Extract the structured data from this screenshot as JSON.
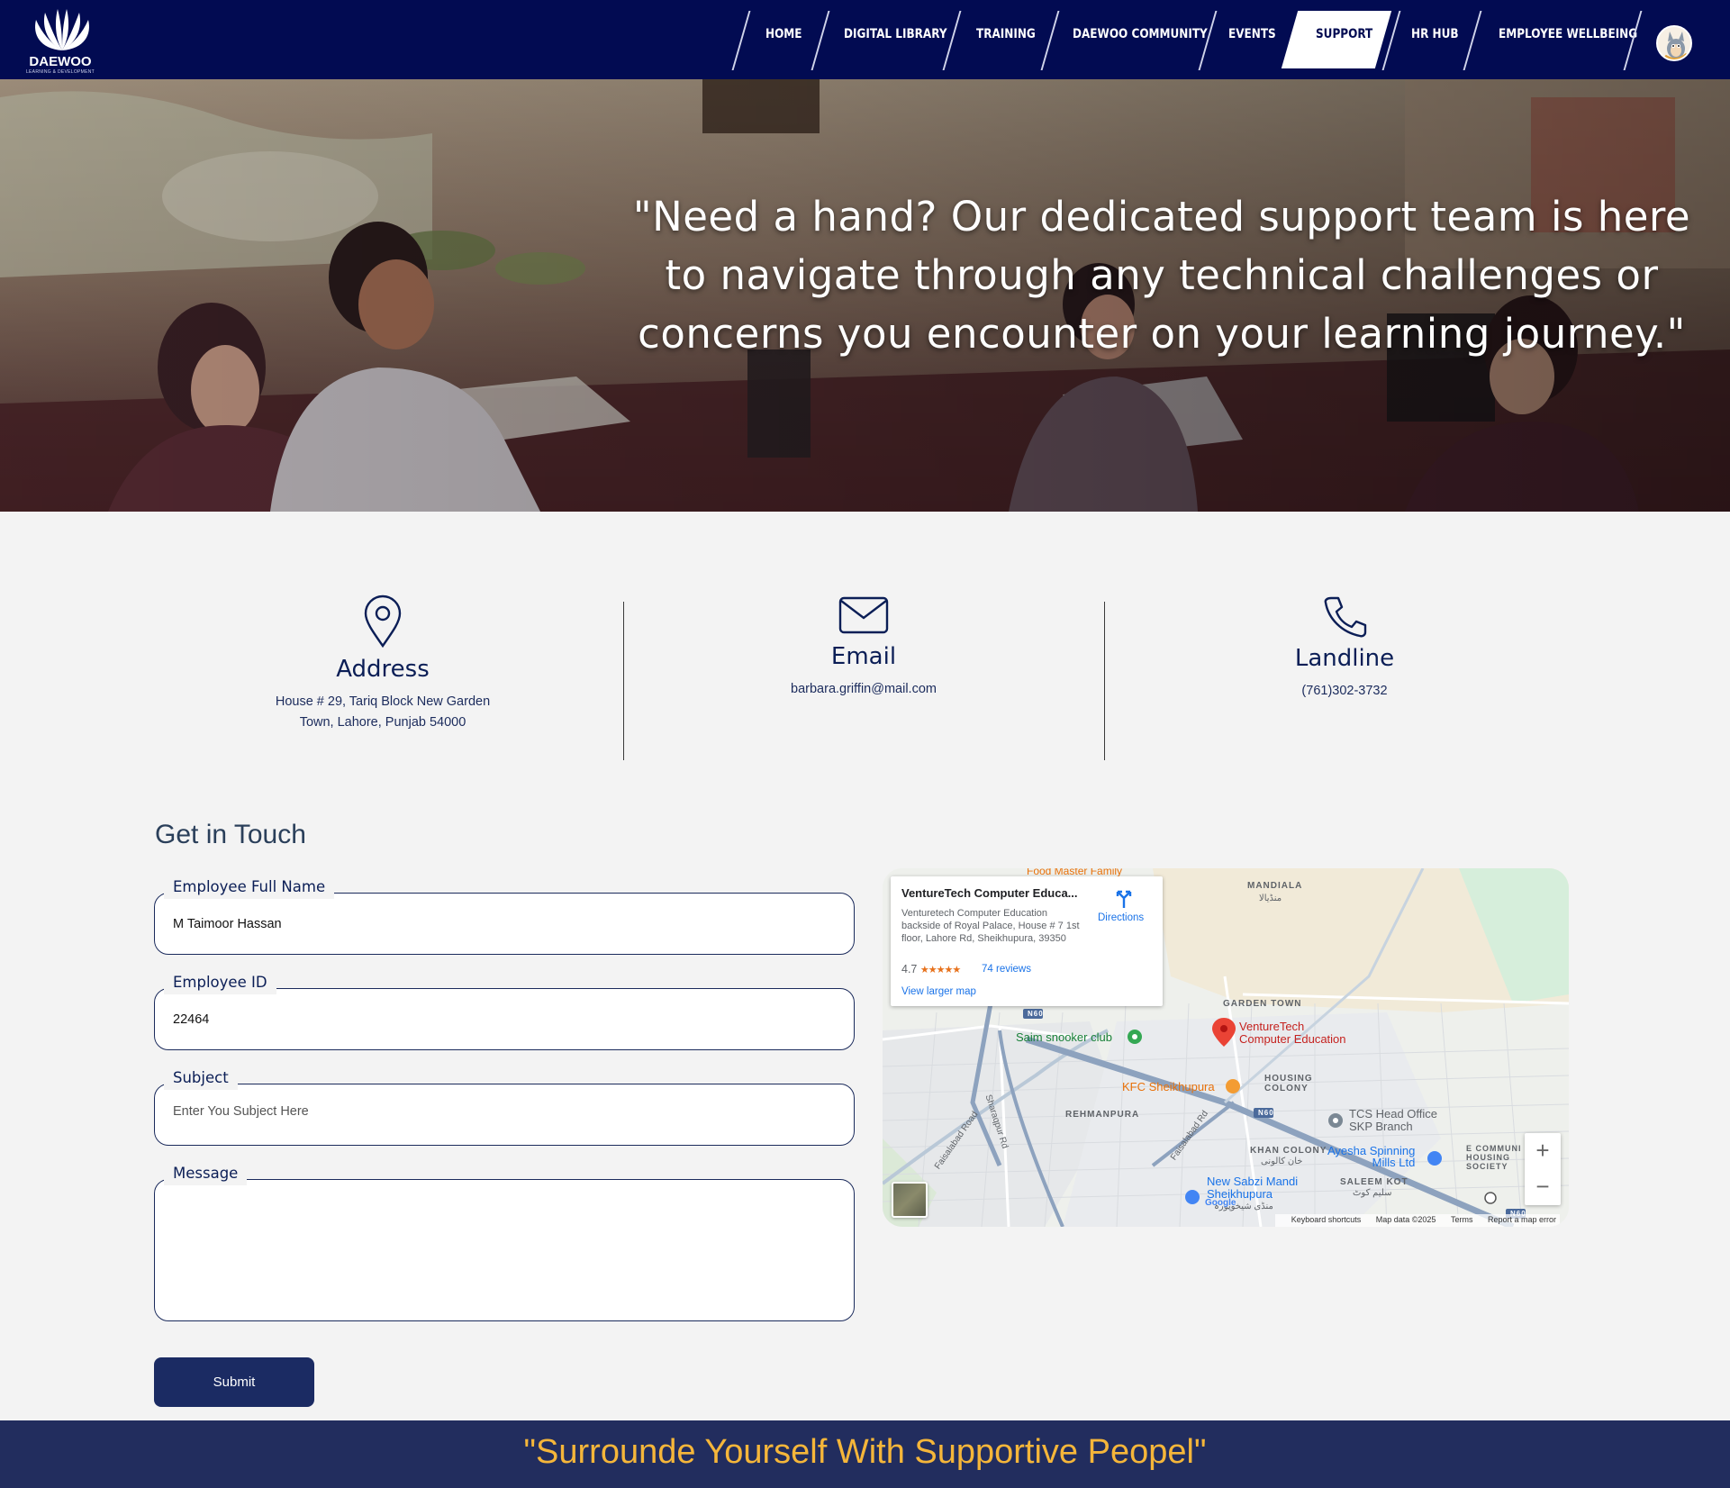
{
  "brand": {
    "logo_text": "DAEWOO",
    "logo_sub": "LEARNING & DEVELOPMENT"
  },
  "nav": {
    "items": [
      {
        "label": "HOME"
      },
      {
        "label": "DIGITAL LIBRARY"
      },
      {
        "label": "TRAINING"
      },
      {
        "label": "DAEWOO COMMUNITY"
      },
      {
        "label": "EVENTS"
      },
      {
        "label": "SUPPORT",
        "active": true
      },
      {
        "label": "HR HUB"
      },
      {
        "label": "EMPLOYEE WELLBEING"
      }
    ]
  },
  "hero": {
    "quote": "\"Need a hand? Our dedicated support team is here to navigate through any technical challenges or concerns you encounter on your learning journey.\""
  },
  "contact": {
    "address": {
      "title": "Address",
      "line1": "House # 29, Tariq Block New Garden",
      "line2": "Town, Lahore, Punjab 54000",
      "icon": "map-pin-icon"
    },
    "email": {
      "title": "Email",
      "value": "barbara.griffin@mail.com",
      "icon": "envelope-icon"
    },
    "landline": {
      "title": "Landline",
      "value": "(761)302-3732",
      "icon": "phone-icon"
    }
  },
  "form": {
    "title": "Get in Touch",
    "full_name": {
      "label": "Employee Full Name",
      "value": "M Taimoor Hassan"
    },
    "employee_id": {
      "label": "Employee ID",
      "value": "22464"
    },
    "subject": {
      "label": "Subject",
      "placeholder": "Enter You Subject Here"
    },
    "message": {
      "label": "Message"
    },
    "submit_label": "Submit"
  },
  "map": {
    "place_name": "VentureTech Computer Educa...",
    "place_address": "Venturetech Computer Education backside of Royal Palace, House # 7 1st floor, Lahore Rd, Sheikhupura, 39350",
    "rating": "4.7",
    "stars": "★★★★★",
    "reviews": "74 reviews",
    "view_larger": "View larger map",
    "directions": "Directions",
    "labels": {
      "food_master": "Food Master Family",
      "mandiala": "MANDIALA",
      "mandiala_urdu": "منڈیالا",
      "garden_town": "GARDEN TOWN",
      "venturetech": "VentureTech\nComputer Education",
      "saim": "Saim snooker club",
      "kfc": "KFC Sheikhupura",
      "housing_colony": "HOUSING\nCOLONY",
      "tcs": "TCS Head Office\nSKP Branch",
      "rehmanpura": "REHMANPURA",
      "khan_colony": "KHAN COLONY",
      "khan_colony_urdu": "خان کالونی",
      "ayesha": "Ayesha Spinning\nMills Ltd",
      "e_communi": "E COMMUNI\nHOUSING\nSOCIETY",
      "sabzi_mandi": "New Sabzi Mandi\nSheikhupura",
      "sabzi_urdu": "منڈی شیخوپورہ",
      "saleem_kot": "SALEEM KOT",
      "saleem_urdu": "سلیم کوٹ",
      "sharaqpur": "Sharaqpur Rd",
      "faisalabad": "Faisalabad Road",
      "faisalabad_rd": "Faisalabad Rd",
      "n60_a": "N60",
      "n60_b": "N60",
      "n60_c": "N60"
    },
    "google": "Google",
    "footer": {
      "keyboard": "Keyboard shortcuts",
      "data": "Map data ©2025",
      "terms": "Terms",
      "report": "Report a map error"
    }
  },
  "footer": {
    "quote": "\"Surrounde Yourself With Supportive Peopel\""
  },
  "colors": {
    "nav_bg": "#020b52",
    "accent": "#1b2b63",
    "footer_bg": "#222d5e",
    "footer_text": "#f5b63a"
  }
}
